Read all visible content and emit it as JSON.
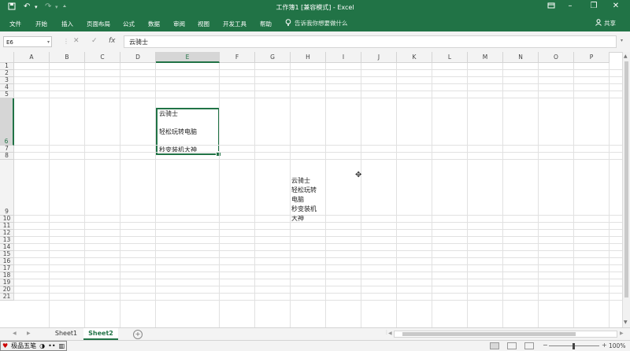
{
  "window": {
    "title": "工作簿1  [兼容模式]  -  Excel",
    "save_icon": "save-icon",
    "undo_icon": "undo-icon",
    "redo_icon": "redo-icon",
    "customize_icon": "customize-qat-icon",
    "controls": [
      "ribbon-display-icon",
      "minimize-icon",
      "restore-icon",
      "close-icon"
    ]
  },
  "ribbon": {
    "tabs": [
      "文件",
      "开始",
      "插入",
      "页面布局",
      "公式",
      "数据",
      "审阅",
      "视图",
      "开发工具",
      "帮助"
    ],
    "tell_me": "告诉我你想要做什么",
    "share": "共享"
  },
  "formula_bar": {
    "name_box": "E6",
    "cancel_symbol": "✕",
    "enter_symbol": "✓",
    "fx_label": "fx",
    "content": "云骑士"
  },
  "columns": [
    "A",
    "B",
    "C",
    "D",
    "E",
    "F",
    "G",
    "H",
    "I",
    "J",
    "K",
    "L",
    "M",
    "N",
    "O",
    "P"
  ],
  "rows": [
    "1",
    "2",
    "3",
    "4",
    "5",
    "6",
    "7",
    "8",
    "9",
    "10",
    "11",
    "12",
    "13",
    "14",
    "15",
    "16",
    "17",
    "18",
    "19",
    "20",
    "21"
  ],
  "selected_cell": {
    "ref": "E6",
    "column": "E",
    "row": "6"
  },
  "cells": {
    "E6": {
      "lines": [
        "云骑士",
        "",
        "轻松玩转电脑",
        "",
        "秒变装机大神"
      ]
    },
    "H9": {
      "lines": [
        "云骑士",
        "轻松玩转",
        "电脑",
        "秒变装机",
        "大神"
      ]
    }
  },
  "sheets": {
    "tabs": [
      "Sheet1",
      "Sheet2"
    ],
    "active": "Sheet2",
    "add_label": "+"
  },
  "status": {
    "ime": [
      "极品五笔",
      "◑",
      "••",
      "▥"
    ],
    "zoom_minus": "−",
    "zoom_plus": "+",
    "zoom": "100%"
  }
}
